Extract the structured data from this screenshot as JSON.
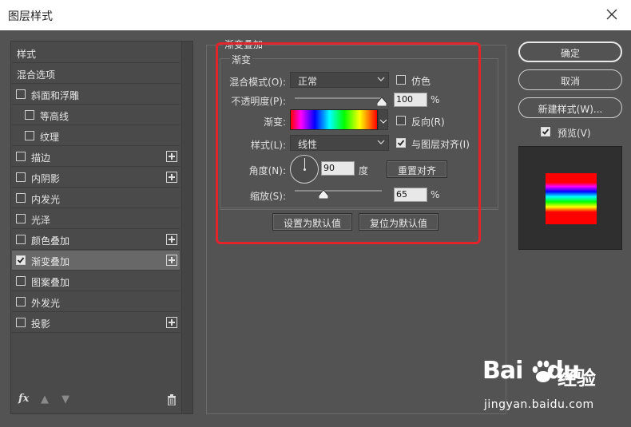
{
  "window": {
    "title": "图层样式"
  },
  "sidebar": {
    "items": [
      {
        "label": "样式",
        "checkbox": false,
        "checked": false,
        "plus": false,
        "indent": 0,
        "selected": false
      },
      {
        "label": "混合选项",
        "checkbox": false,
        "checked": false,
        "plus": false,
        "indent": 0,
        "selected": false
      },
      {
        "label": "斜面和浮雕",
        "checkbox": true,
        "checked": false,
        "plus": false,
        "indent": 0,
        "selected": false
      },
      {
        "label": "等高线",
        "checkbox": true,
        "checked": false,
        "plus": false,
        "indent": 1,
        "selected": false
      },
      {
        "label": "纹理",
        "checkbox": true,
        "checked": false,
        "plus": false,
        "indent": 1,
        "selected": false
      },
      {
        "label": "描边",
        "checkbox": true,
        "checked": false,
        "plus": true,
        "indent": 0,
        "selected": false
      },
      {
        "label": "内阴影",
        "checkbox": true,
        "checked": false,
        "plus": true,
        "indent": 0,
        "selected": false
      },
      {
        "label": "内发光",
        "checkbox": true,
        "checked": false,
        "plus": false,
        "indent": 0,
        "selected": false
      },
      {
        "label": "光泽",
        "checkbox": true,
        "checked": false,
        "plus": false,
        "indent": 0,
        "selected": false
      },
      {
        "label": "颜色叠加",
        "checkbox": true,
        "checked": false,
        "plus": true,
        "indent": 0,
        "selected": false
      },
      {
        "label": "渐变叠加",
        "checkbox": true,
        "checked": true,
        "plus": true,
        "indent": 0,
        "selected": true
      },
      {
        "label": "图案叠加",
        "checkbox": true,
        "checked": false,
        "plus": false,
        "indent": 0,
        "selected": false
      },
      {
        "label": "外发光",
        "checkbox": true,
        "checked": false,
        "plus": false,
        "indent": 0,
        "selected": false
      },
      {
        "label": "投影",
        "checkbox": true,
        "checked": false,
        "plus": true,
        "indent": 0,
        "selected": false
      }
    ],
    "fx_label": "fx"
  },
  "panel": {
    "section_title": "渐变叠加",
    "group_title": "渐变",
    "blend_mode_label": "混合模式(O):",
    "blend_mode_value": "正常",
    "dither_label": "仿色",
    "dither_checked": false,
    "opacity_label": "不透明度(P):",
    "opacity_value": "100",
    "opacity_fraction": 1.0,
    "percent": "%",
    "gradient_label": "渐变:",
    "reverse_label": "反向(R)",
    "reverse_checked": false,
    "style_label": "样式(L):",
    "style_value": "线性",
    "align_label": "与图层对齐(I)",
    "align_checked": true,
    "angle_label": "角度(N):",
    "angle_value": "90",
    "degree_unit": "度",
    "reset_align_button": "重置对齐",
    "scale_label": "缩放(S):",
    "scale_value": "65",
    "scale_fraction": 0.333,
    "set_default_button": "设置为默认值",
    "reset_default_button": "复位为默认值"
  },
  "actions": {
    "ok": "确定",
    "cancel": "取消",
    "new_style": "新建样式(W)...",
    "preview_label": "预览(V)",
    "preview_checked": true
  },
  "watermark": {
    "brand": "Bai",
    "brand2": "du",
    "cn": "经验",
    "url": "jingyan.baidu.com"
  },
  "colors": {
    "dialog_bg": "#535353",
    "highlight": "#e3242b",
    "selected_row": "#686868"
  }
}
